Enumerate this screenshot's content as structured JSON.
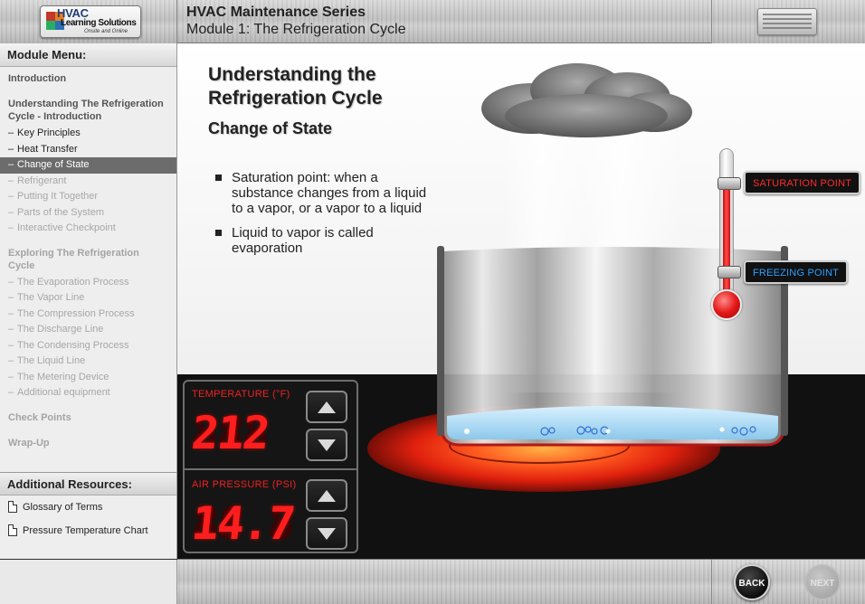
{
  "header": {
    "logo_text_line1": "HVAC",
    "logo_text_line2": "Learning Solutions",
    "logo_tagline": "Onsite and Online",
    "series_title": "HVAC Maintenance Series",
    "module_title": "Module 1: The Refrigeration Cycle"
  },
  "sidebar": {
    "menu_heading": "Module Menu:",
    "sections": [
      {
        "label": "Introduction",
        "enabled": true,
        "items": []
      },
      {
        "label": "Understanding The Refrigeration Cycle - Introduction",
        "enabled": true,
        "items": [
          {
            "label": "Key Principles",
            "state": "normal"
          },
          {
            "label": "Heat Transfer",
            "state": "normal"
          },
          {
            "label": "Change of State",
            "state": "active"
          },
          {
            "label": "Refrigerant",
            "state": "disabled"
          },
          {
            "label": "Putting It Together",
            "state": "disabled"
          },
          {
            "label": "Parts of the System",
            "state": "disabled"
          },
          {
            "label": "Interactive Checkpoint",
            "state": "disabled"
          }
        ]
      },
      {
        "label": "Exploring The Refrigeration Cycle",
        "enabled": false,
        "items": [
          {
            "label": "The Evaporation Process",
            "state": "disabled"
          },
          {
            "label": "The Vapor Line",
            "state": "disabled"
          },
          {
            "label": "The Compression Process",
            "state": "disabled"
          },
          {
            "label": "The Discharge Line",
            "state": "disabled"
          },
          {
            "label": "The Condensing Process",
            "state": "disabled"
          },
          {
            "label": "The Liquid Line",
            "state": "disabled"
          },
          {
            "label": "The Metering Device",
            "state": "disabled"
          },
          {
            "label": "Additional equipment",
            "state": "disabled"
          }
        ]
      },
      {
        "label": "Check Points",
        "enabled": false,
        "items": []
      },
      {
        "label": "Wrap-Up",
        "enabled": false,
        "items": []
      }
    ],
    "resources_heading": "Additional Resources:",
    "resources": [
      {
        "label": "Glossary of Terms"
      },
      {
        "label": "Pressure Temperature Chart"
      }
    ]
  },
  "content": {
    "title": "Understanding the Refrigeration Cycle",
    "subtitle": "Change of State",
    "bullets": [
      "Saturation point: when a substance changes from a liquid to a vapor, or a vapor to a liquid",
      "Liquid to vapor is called evaporation"
    ],
    "saturation_label": "SATURATION POINT",
    "freezing_label": "FREEZING POINT",
    "thermometer_level": 0.85
  },
  "panel": {
    "temperature_label": "TEMPERATURE (°F)",
    "temperature_value": "212",
    "pressure_label": "AIR PRESSURE (PSI)",
    "pressure_value": "14.7"
  },
  "footer": {
    "back_label": "BACK",
    "next_label": "NEXT",
    "next_enabled": false
  },
  "colors": {
    "accent_red": "#ff1e1e",
    "freezing_blue": "#2aa0ff",
    "active_menu_bg": "#6c6c6c"
  }
}
